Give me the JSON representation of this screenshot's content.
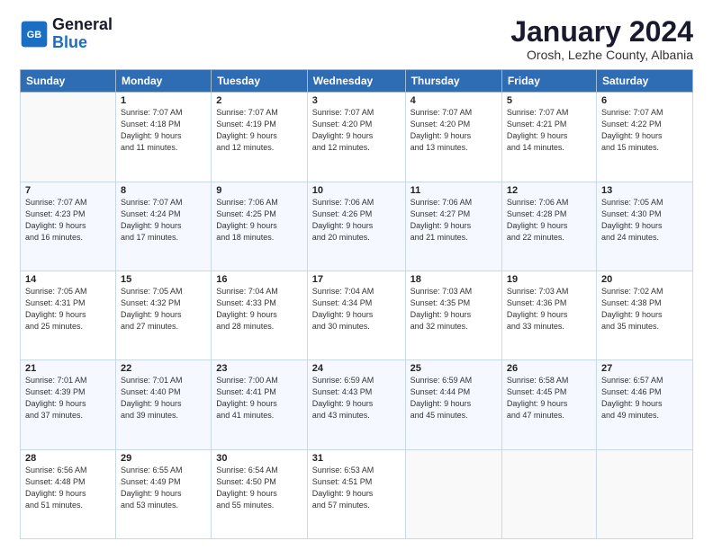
{
  "logo": {
    "line1": "General",
    "line2": "Blue"
  },
  "title": "January 2024",
  "subtitle": "Orosh, Lezhe County, Albania",
  "weekdays": [
    "Sunday",
    "Monday",
    "Tuesday",
    "Wednesday",
    "Thursday",
    "Friday",
    "Saturday"
  ],
  "weeks": [
    [
      {
        "day": "",
        "info": ""
      },
      {
        "day": "1",
        "info": "Sunrise: 7:07 AM\nSunset: 4:18 PM\nDaylight: 9 hours\nand 11 minutes."
      },
      {
        "day": "2",
        "info": "Sunrise: 7:07 AM\nSunset: 4:19 PM\nDaylight: 9 hours\nand 12 minutes."
      },
      {
        "day": "3",
        "info": "Sunrise: 7:07 AM\nSunset: 4:20 PM\nDaylight: 9 hours\nand 12 minutes."
      },
      {
        "day": "4",
        "info": "Sunrise: 7:07 AM\nSunset: 4:20 PM\nDaylight: 9 hours\nand 13 minutes."
      },
      {
        "day": "5",
        "info": "Sunrise: 7:07 AM\nSunset: 4:21 PM\nDaylight: 9 hours\nand 14 minutes."
      },
      {
        "day": "6",
        "info": "Sunrise: 7:07 AM\nSunset: 4:22 PM\nDaylight: 9 hours\nand 15 minutes."
      }
    ],
    [
      {
        "day": "7",
        "info": "Sunrise: 7:07 AM\nSunset: 4:23 PM\nDaylight: 9 hours\nand 16 minutes."
      },
      {
        "day": "8",
        "info": "Sunrise: 7:07 AM\nSunset: 4:24 PM\nDaylight: 9 hours\nand 17 minutes."
      },
      {
        "day": "9",
        "info": "Sunrise: 7:06 AM\nSunset: 4:25 PM\nDaylight: 9 hours\nand 18 minutes."
      },
      {
        "day": "10",
        "info": "Sunrise: 7:06 AM\nSunset: 4:26 PM\nDaylight: 9 hours\nand 20 minutes."
      },
      {
        "day": "11",
        "info": "Sunrise: 7:06 AM\nSunset: 4:27 PM\nDaylight: 9 hours\nand 21 minutes."
      },
      {
        "day": "12",
        "info": "Sunrise: 7:06 AM\nSunset: 4:28 PM\nDaylight: 9 hours\nand 22 minutes."
      },
      {
        "day": "13",
        "info": "Sunrise: 7:05 AM\nSunset: 4:30 PM\nDaylight: 9 hours\nand 24 minutes."
      }
    ],
    [
      {
        "day": "14",
        "info": "Sunrise: 7:05 AM\nSunset: 4:31 PM\nDaylight: 9 hours\nand 25 minutes."
      },
      {
        "day": "15",
        "info": "Sunrise: 7:05 AM\nSunset: 4:32 PM\nDaylight: 9 hours\nand 27 minutes."
      },
      {
        "day": "16",
        "info": "Sunrise: 7:04 AM\nSunset: 4:33 PM\nDaylight: 9 hours\nand 28 minutes."
      },
      {
        "day": "17",
        "info": "Sunrise: 7:04 AM\nSunset: 4:34 PM\nDaylight: 9 hours\nand 30 minutes."
      },
      {
        "day": "18",
        "info": "Sunrise: 7:03 AM\nSunset: 4:35 PM\nDaylight: 9 hours\nand 32 minutes."
      },
      {
        "day": "19",
        "info": "Sunrise: 7:03 AM\nSunset: 4:36 PM\nDaylight: 9 hours\nand 33 minutes."
      },
      {
        "day": "20",
        "info": "Sunrise: 7:02 AM\nSunset: 4:38 PM\nDaylight: 9 hours\nand 35 minutes."
      }
    ],
    [
      {
        "day": "21",
        "info": "Sunrise: 7:01 AM\nSunset: 4:39 PM\nDaylight: 9 hours\nand 37 minutes."
      },
      {
        "day": "22",
        "info": "Sunrise: 7:01 AM\nSunset: 4:40 PM\nDaylight: 9 hours\nand 39 minutes."
      },
      {
        "day": "23",
        "info": "Sunrise: 7:00 AM\nSunset: 4:41 PM\nDaylight: 9 hours\nand 41 minutes."
      },
      {
        "day": "24",
        "info": "Sunrise: 6:59 AM\nSunset: 4:43 PM\nDaylight: 9 hours\nand 43 minutes."
      },
      {
        "day": "25",
        "info": "Sunrise: 6:59 AM\nSunset: 4:44 PM\nDaylight: 9 hours\nand 45 minutes."
      },
      {
        "day": "26",
        "info": "Sunrise: 6:58 AM\nSunset: 4:45 PM\nDaylight: 9 hours\nand 47 minutes."
      },
      {
        "day": "27",
        "info": "Sunrise: 6:57 AM\nSunset: 4:46 PM\nDaylight: 9 hours\nand 49 minutes."
      }
    ],
    [
      {
        "day": "28",
        "info": "Sunrise: 6:56 AM\nSunset: 4:48 PM\nDaylight: 9 hours\nand 51 minutes."
      },
      {
        "day": "29",
        "info": "Sunrise: 6:55 AM\nSunset: 4:49 PM\nDaylight: 9 hours\nand 53 minutes."
      },
      {
        "day": "30",
        "info": "Sunrise: 6:54 AM\nSunset: 4:50 PM\nDaylight: 9 hours\nand 55 minutes."
      },
      {
        "day": "31",
        "info": "Sunrise: 6:53 AM\nSunset: 4:51 PM\nDaylight: 9 hours\nand 57 minutes."
      },
      {
        "day": "",
        "info": ""
      },
      {
        "day": "",
        "info": ""
      },
      {
        "day": "",
        "info": ""
      }
    ]
  ]
}
